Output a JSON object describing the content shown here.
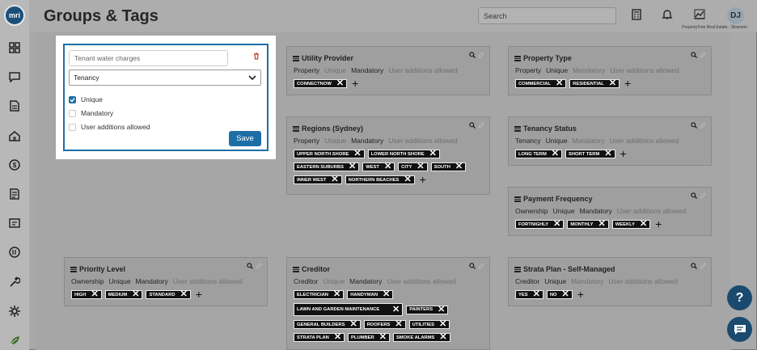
{
  "app": {
    "logo_text": "mri",
    "title": "Groups & Tags"
  },
  "header": {
    "search_placeholder": "Search",
    "avatar_initials": "DJ",
    "company": "PropertyTree Real Estate - Shannon"
  },
  "sidebar": {
    "items": [
      "dashboard-icon",
      "messages-icon",
      "documents-icon",
      "properties-icon",
      "money-icon",
      "ledger-icon",
      "inspections-icon",
      "reports-icon",
      "tools-icon",
      "settings-icon",
      "leaf-icon"
    ]
  },
  "modal": {
    "name_value": "Tenant water charges",
    "group_value": "Tenancy",
    "options": [
      {
        "label": "Unique",
        "checked": true
      },
      {
        "label": "Mandatory",
        "checked": false
      },
      {
        "label": "User additions allowed",
        "checked": false
      }
    ],
    "save_label": "Save"
  },
  "cards": [
    {
      "title": "Utility Provider",
      "props": [
        {
          "t": "Property",
          "on": true
        },
        {
          "t": "Unique",
          "on": false
        },
        {
          "t": "Mandatory",
          "on": true
        },
        {
          "t": "User additions allowed",
          "on": false
        }
      ],
      "tags": [
        "CONNECTNOW"
      ]
    },
    {
      "title": "Property Type",
      "props": [
        {
          "t": "Property",
          "on": true
        },
        {
          "t": "Unique",
          "on": true
        },
        {
          "t": "Mandatory",
          "on": false
        },
        {
          "t": "User additions allowed",
          "on": false
        }
      ],
      "tags": [
        "COMMERCIAL",
        "RESIDENTIAL"
      ]
    },
    {
      "title": "Regions (Sydney)",
      "props": [
        {
          "t": "Property",
          "on": true
        },
        {
          "t": "Unique",
          "on": false
        },
        {
          "t": "Mandatory",
          "on": true
        },
        {
          "t": "User additions allowed",
          "on": false
        }
      ],
      "tags": [
        "UPPER NORTH SHORE",
        "LOWER NORTH SHORE",
        "EASTERN SUBURBS",
        "WEST",
        "CITY",
        "SOUTH",
        "INNER WEST",
        "NORTHERN BEACHES"
      ]
    },
    {
      "title": "Tenancy Status",
      "props": [
        {
          "t": "Tenancy",
          "on": true
        },
        {
          "t": "Unique",
          "on": true
        },
        {
          "t": "Mandatory",
          "on": false
        },
        {
          "t": "User additions allowed",
          "on": false
        }
      ],
      "tags": [
        "LONG TERM",
        "SHORT TERM"
      ]
    },
    {
      "title": "Payment Frequency",
      "props": [
        {
          "t": "Ownership",
          "on": true
        },
        {
          "t": "Unique",
          "on": true
        },
        {
          "t": "Mandatory",
          "on": true
        },
        {
          "t": "User additions allowed",
          "on": false
        }
      ],
      "tags": [
        "FORTNIGHLY",
        "MONTHLY",
        "WEEKLY"
      ]
    },
    {
      "title": "Priority Level",
      "props": [
        {
          "t": "Ownership",
          "on": true
        },
        {
          "t": "Unique",
          "on": true
        },
        {
          "t": "Mandatory",
          "on": true
        },
        {
          "t": "User additions allowed",
          "on": false
        }
      ],
      "tags": [
        "HIGH",
        "MEDIUM",
        "STANDARD"
      ]
    },
    {
      "title": "Creditor",
      "props": [
        {
          "t": "Creditor",
          "on": true
        },
        {
          "t": "Unique",
          "on": false
        },
        {
          "t": "Mandatory",
          "on": true
        },
        {
          "t": "User additions allowed",
          "on": false
        }
      ],
      "tags": [
        "ELECTRICIAN",
        "HANDYMAN",
        "LAWN AND GARDEN MAINTENANCE",
        "PAINTERS",
        "GENERAL BUILDERS",
        "ROOFERS",
        "UTILITIES",
        "STRATA PLAN",
        "PLUMBER",
        "SMOKE ALARMS"
      ]
    },
    {
      "title": "Strata Plan - Self-Managed",
      "props": [
        {
          "t": "Creditor",
          "on": true
        },
        {
          "t": "Unique",
          "on": true
        },
        {
          "t": "Mandatory",
          "on": false
        },
        {
          "t": "User additions allowed",
          "on": false
        }
      ],
      "tags": [
        "YES",
        "NO"
      ]
    }
  ],
  "help": {
    "question_label": "?"
  }
}
